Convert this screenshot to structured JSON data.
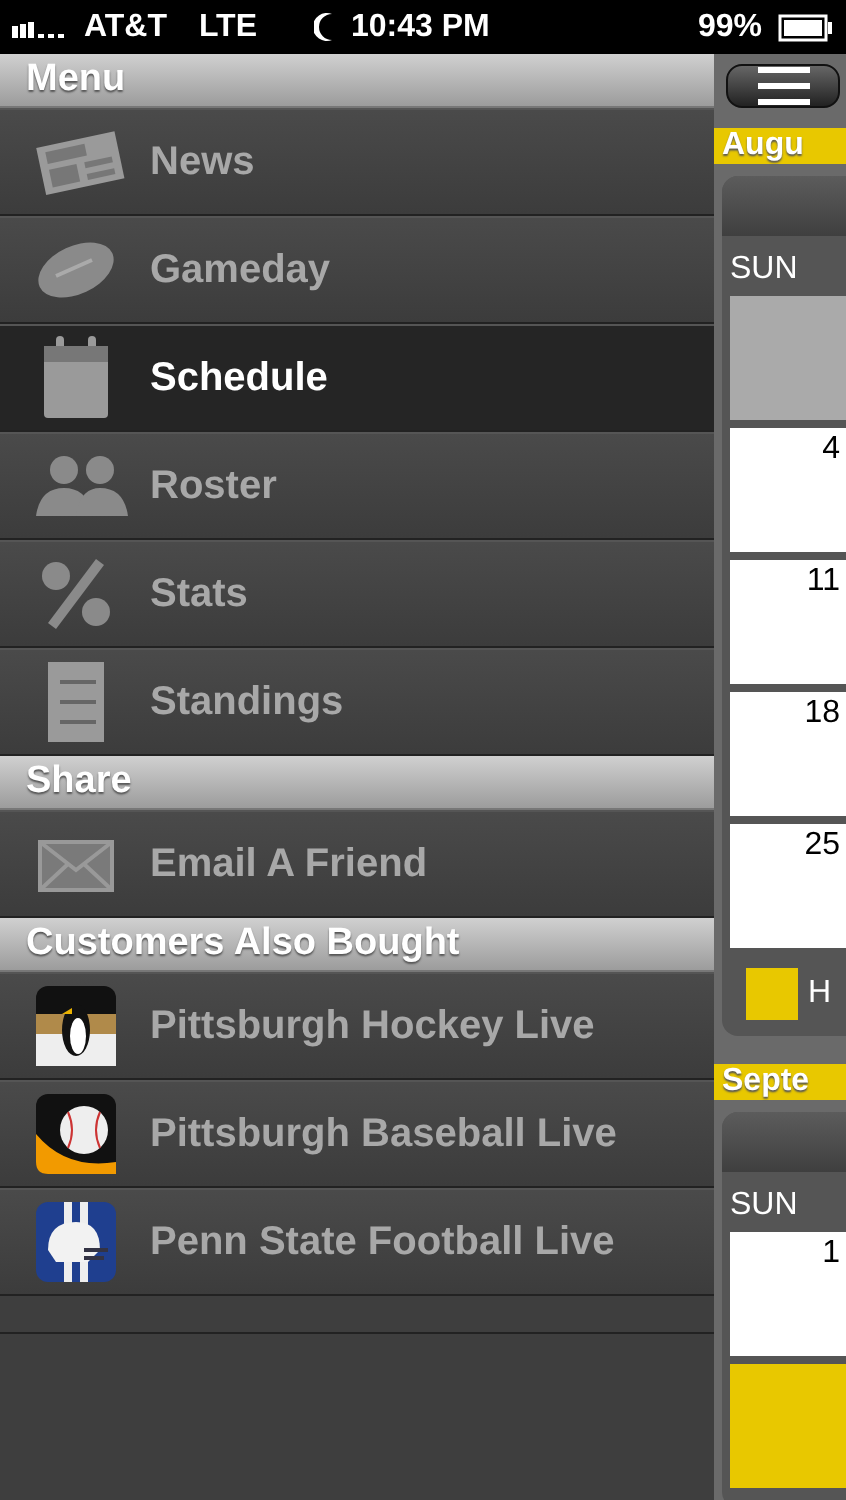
{
  "status_bar": {
    "carrier": "AT&T",
    "network": "LTE",
    "time": "10:43 PM",
    "battery": "99%"
  },
  "menu": [
    {
      "title": "Menu",
      "items": [
        {
          "label": "News",
          "kind": "news",
          "selected": false
        },
        {
          "label": "Gameday",
          "kind": "football",
          "selected": false
        },
        {
          "label": "Schedule",
          "kind": "calendar",
          "selected": true
        },
        {
          "label": "Roster",
          "kind": "people",
          "selected": false
        },
        {
          "label": "Stats",
          "kind": "percent",
          "selected": false
        },
        {
          "label": "Standings",
          "kind": "list",
          "selected": false
        }
      ]
    },
    {
      "title": "Share",
      "items": [
        {
          "label": "Email A Friend",
          "kind": "mail",
          "selected": false
        }
      ]
    },
    {
      "title": "Customers Also Bought",
      "items": [
        {
          "label": "Pittsburgh Hockey Live",
          "kind": "hockey",
          "selected": false
        },
        {
          "label": "Pittsburgh Baseball Live",
          "kind": "baseball",
          "selected": false
        },
        {
          "label": "Penn State Football Live",
          "kind": "helmet",
          "selected": false
        }
      ]
    }
  ],
  "calendar": {
    "months": [
      {
        "name": "Augu",
        "weekday": "SUN",
        "cells": [
          {
            "kind": "blank"
          },
          {
            "kind": "day",
            "day": "4"
          },
          {
            "kind": "day",
            "day": "11"
          },
          {
            "kind": "day",
            "day": "18"
          },
          {
            "kind": "day",
            "day": "25"
          }
        ],
        "legend": {
          "label": "H",
          "color": "#e8c800"
        }
      },
      {
        "name": "Septe",
        "weekday": "SUN",
        "cells": [
          {
            "kind": "day",
            "day": "1"
          },
          {
            "kind": "home"
          }
        ]
      }
    ]
  }
}
